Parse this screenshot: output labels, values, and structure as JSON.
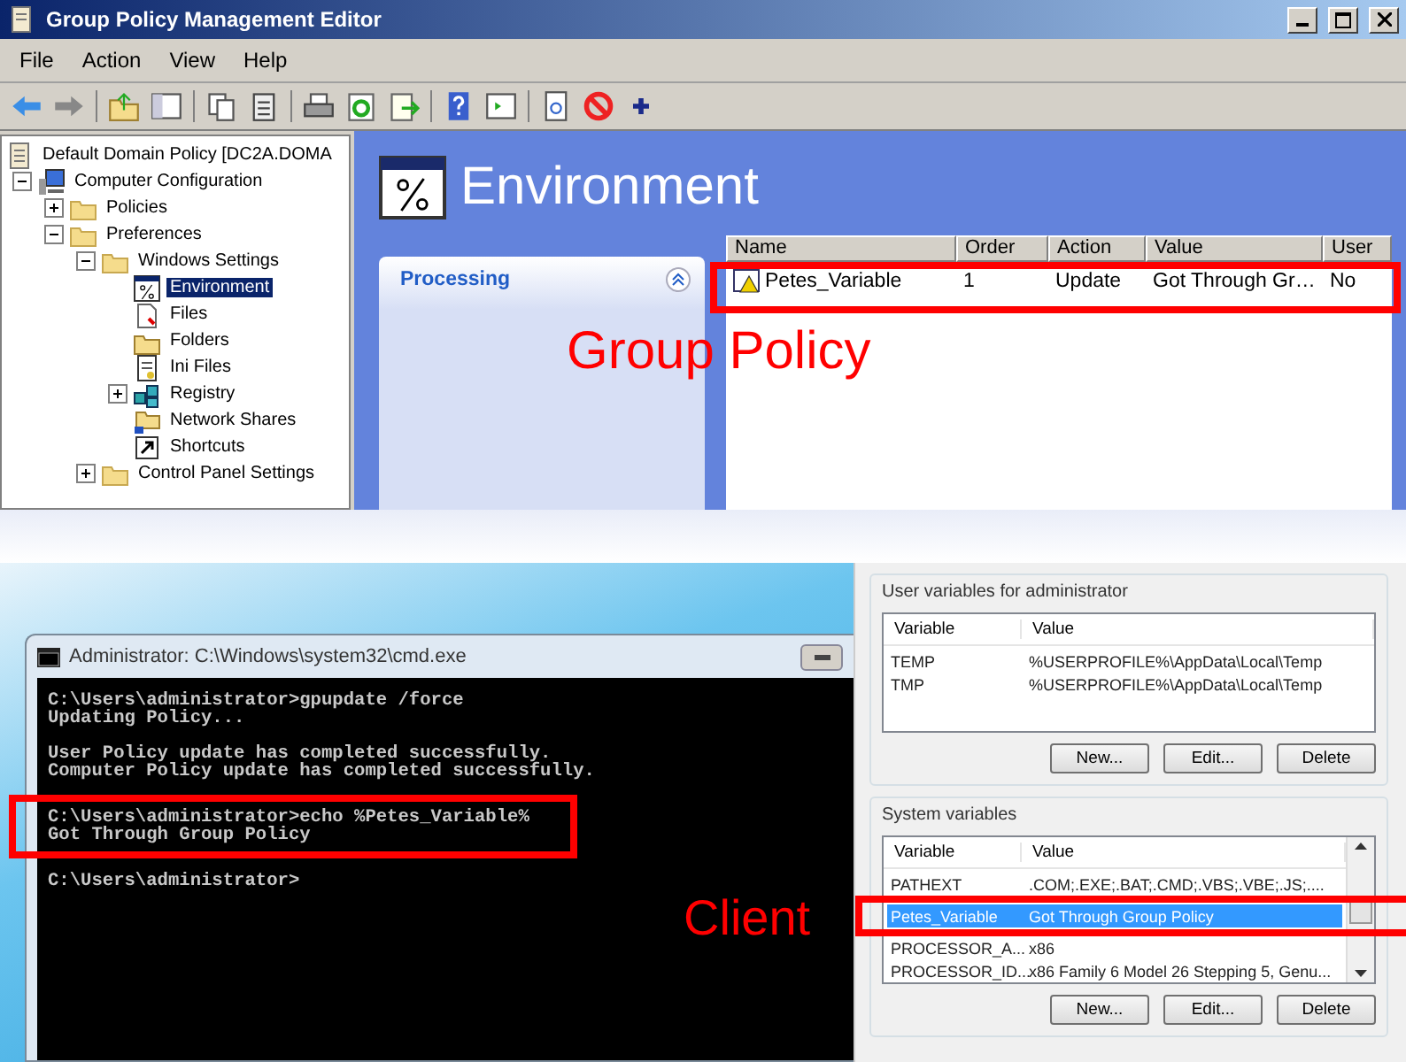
{
  "gpme": {
    "title": "Group Policy Management Editor",
    "menu": [
      "File",
      "Action",
      "View",
      "Help"
    ],
    "tree": [
      {
        "label": "Default Domain Policy [DC2A.DOMA",
        "kind": "policy",
        "selected": false,
        "children": [
          {
            "label": "Computer Configuration",
            "kind": "computer",
            "selected": false,
            "expanded": true,
            "children": [
              {
                "label": "Policies",
                "kind": "folder",
                "selected": false,
                "expanded": false
              },
              {
                "label": "Preferences",
                "kind": "folder",
                "selected": false,
                "expanded": true,
                "children": [
                  {
                    "label": "Windows Settings",
                    "kind": "folder",
                    "selected": false,
                    "expanded": true,
                    "children": [
                      {
                        "label": "Environment",
                        "kind": "environment",
                        "selected": true
                      },
                      {
                        "label": "Files",
                        "kind": "files",
                        "selected": false
                      },
                      {
                        "label": "Folders",
                        "kind": "folders",
                        "selected": false
                      },
                      {
                        "label": "Ini Files",
                        "kind": "ini",
                        "selected": false
                      },
                      {
                        "label": "Registry",
                        "kind": "registry",
                        "selected": false,
                        "expanded": false
                      },
                      {
                        "label": "Network Shares",
                        "kind": "shares",
                        "selected": false
                      },
                      {
                        "label": "Shortcuts",
                        "kind": "shortcut",
                        "selected": false
                      }
                    ]
                  },
                  {
                    "label": "Control Panel Settings",
                    "kind": "folder",
                    "selected": false,
                    "expanded": false
                  }
                ]
              }
            ]
          }
        ]
      }
    ],
    "pane_title": "Environment",
    "processing": "Processing",
    "columns": [
      "Name",
      "Order",
      "Action",
      "Value",
      "User"
    ],
    "rows": [
      {
        "cells": [
          "Petes_Variable",
          "1",
          "Update",
          "Got Through Gr…",
          "No"
        ],
        "highlighted": true
      }
    ]
  },
  "cmd": {
    "title": "Administrator: C:\\Windows\\system32\\cmd.exe",
    "blocks": [
      {
        "lines": [
          "C:\\Users\\administrator>gpupdate /force",
          "Updating Policy..."
        ],
        "highlighted": false
      },
      {
        "lines": [
          "User Policy update has completed successfully.",
          "Computer Policy update has completed successfully."
        ],
        "highlighted": false
      },
      {
        "lines": [
          "C:\\Users\\administrator>echo %Petes_Variable%",
          "Got Through Group Policy"
        ],
        "highlighted": true
      },
      {
        "lines": [
          "C:\\Users\\administrator>"
        ],
        "highlighted": false
      }
    ]
  },
  "env": {
    "groups": [
      {
        "title": "User variables for administrator",
        "columns": [
          "Variable",
          "Value"
        ],
        "scrollbar": false,
        "rows": [
          {
            "cells": [
              "TEMP",
              "%USERPROFILE%\\AppData\\Local\\Temp"
            ],
            "selected": false,
            "highlighted": false
          },
          {
            "cells": [
              "TMP",
              "%USERPROFILE%\\AppData\\Local\\Temp"
            ],
            "selected": false,
            "highlighted": false
          }
        ],
        "buttons": [
          "New...",
          "Edit...",
          "Delete"
        ]
      },
      {
        "title": "System variables",
        "columns": [
          "Variable",
          "Value"
        ],
        "scrollbar": true,
        "rows": [
          {
            "cells": [
              "PATHEXT",
              ".COM;.EXE;.BAT;.CMD;.VBS;.VBE;.JS;...."
            ],
            "selected": false,
            "highlighted": false
          },
          {
            "cells": [
              "Petes_Variable",
              "Got Through Group Policy"
            ],
            "selected": true,
            "highlighted": true
          },
          {
            "cells": [
              "PROCESSOR_A...",
              "x86"
            ],
            "selected": false,
            "highlighted": false
          },
          {
            "cells": [
              "PROCESSOR_ID...",
              "x86 Family 6 Model 26 Stepping 5, Genu..."
            ],
            "selected": false,
            "highlighted": false
          }
        ],
        "buttons": [
          "New...",
          "Edit...",
          "Delete"
        ]
      }
    ]
  },
  "callouts": [
    {
      "text": "Group Policy"
    },
    {
      "text": "Client"
    }
  ]
}
